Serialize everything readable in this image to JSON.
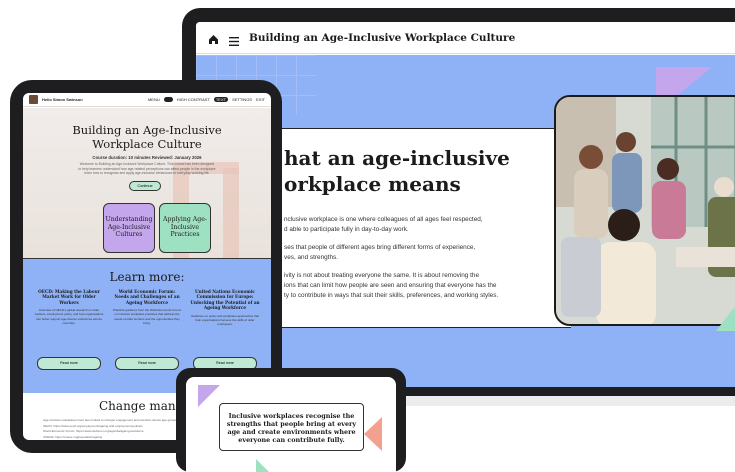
{
  "laptop": {
    "header_title": "Building an Age-Inclusive Workplace Culture",
    "heading_line1": "hat an age-inclusive",
    "heading_line2": "orkplace means",
    "para1_line1": "nclusive workplace is one where colleagues of all ages feel respected,",
    "para1_line2": "d able to participate fully in day-to-day work.",
    "para2_line1": "ses that people of different ages bring different forms of experience,",
    "para2_line2": "ves, and strengths.",
    "para3_line1": "ivity is not about treating everyone the same. It is about removing the",
    "para3_line2": "ions that can limit how people are seen and ensuring that everyone has the",
    "para3_line3": "ty to contribute in ways that suit their skills, preferences, and working styles."
  },
  "tablet": {
    "nav": {
      "brand": "Hello Simon Swinson",
      "items": [
        "MENU",
        "HIGH CONTRAST",
        "TEXT",
        "SETTINGS",
        "EXIT"
      ]
    },
    "title_line1": "Building an Age-Inclusive",
    "title_line2": "Workplace Culture",
    "subtitle": "Course duration: 10 minutes   Reviewed: January 2026",
    "intro_line1": "Welcome to Building an Age-Inclusive Workplace Culture. This course has been designed",
    "intro_line2": "to help learners understand how age-related perceptions can affect people in the workplace",
    "intro_line3": "learn how to recognise and apply age-inclusive behaviours in everyday working life.",
    "continue_button": "Continue",
    "card1": "Understanding Age-Inclusive Cultures",
    "card2": "Applying Age-Inclusive Practices",
    "learn_more": "Learn more:",
    "columns": [
      {
        "title": "OECD: Making the Labour Market Work for Older Workers",
        "body": "Overview of OECD's global research on older workers, employment policy, and how organisations can better support age-diverse workforces across countries."
      },
      {
        "title": "World Economic Forum: Needs and Challenges of an Ageing Workforce",
        "body": "Practical guidance from the World Economic Forum on inclusive workplace practices that address the needs of older workers and the opportunities they bring."
      },
      {
        "title": "United Nations Economic Commission for Europe: Unlocking the Potential of an Ageing Workforce",
        "body": "Guidance on policy and workplace approaches that help organisations harness the skills of older employees."
      }
    ],
    "read_more": "Read more",
    "change_heading": "Change manage",
    "body_line1": "Age-inclusive workplaces have been linked to stronger engagement and retention across age groups",
    "body_line2": "OECD: https://www.oecd.org/employment/ageing-and-employment-policies",
    "body_line3": "World Economic Forum: https://www.weforum.org/agenda/ageing-workforce",
    "body_line4": "UNECE: https://unece.org/population/ageing"
  },
  "phone": {
    "quote": "Inclusive workplaces recognise the strengths that people bring at every age and create environments where everyone can contribute fully."
  },
  "colors": {
    "blue": "#8fb1f5",
    "mint": "#bfe9d3",
    "purple": "#c4a6ec",
    "salmon": "#f4a08e",
    "dark": "#1e1e20"
  }
}
